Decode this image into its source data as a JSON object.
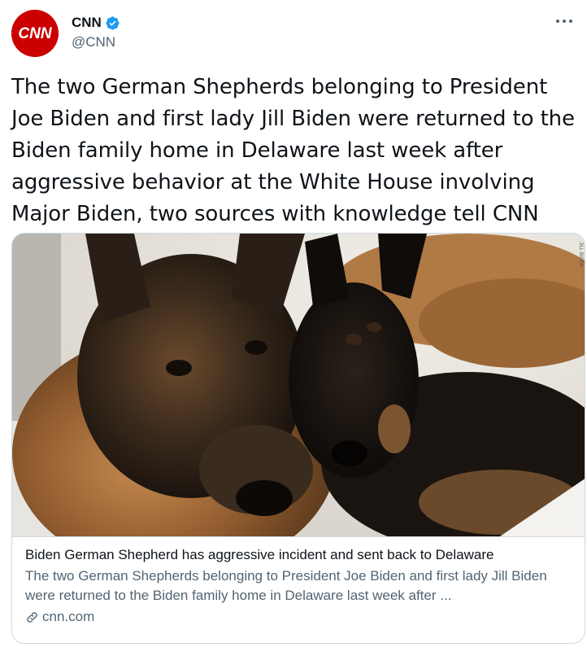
{
  "author": {
    "display_name": "CNN",
    "handle": "@CNN",
    "verified": true,
    "avatar_text": "CNN",
    "avatar_color": "#cc0000"
  },
  "tweet": {
    "text": "The two German Shepherds belonging to President Joe Biden and first lady Jill Biden were returned to the Biden family home in Delaware last week after aggressive behavior at the White House involving Major Biden, two sources with knowledge tell CNN"
  },
  "card": {
    "image_credit": "JILL BIDEN",
    "title": "Biden German Shepherd has aggressive incident and sent back to Delaware",
    "description": "The two German Shepherds belonging to President Joe Biden and first lady Jill Biden were returned to the Biden family home in Delaware last week after ...",
    "domain": "cnn.com"
  },
  "colors": {
    "text_primary": "#0f1419",
    "text_secondary": "#536471",
    "verified_blue": "#1d9bf0",
    "border": "#cfd9de"
  },
  "icons": {
    "more": "more-horizontal-icon",
    "verified": "verified-badge-icon",
    "link": "link-icon"
  }
}
